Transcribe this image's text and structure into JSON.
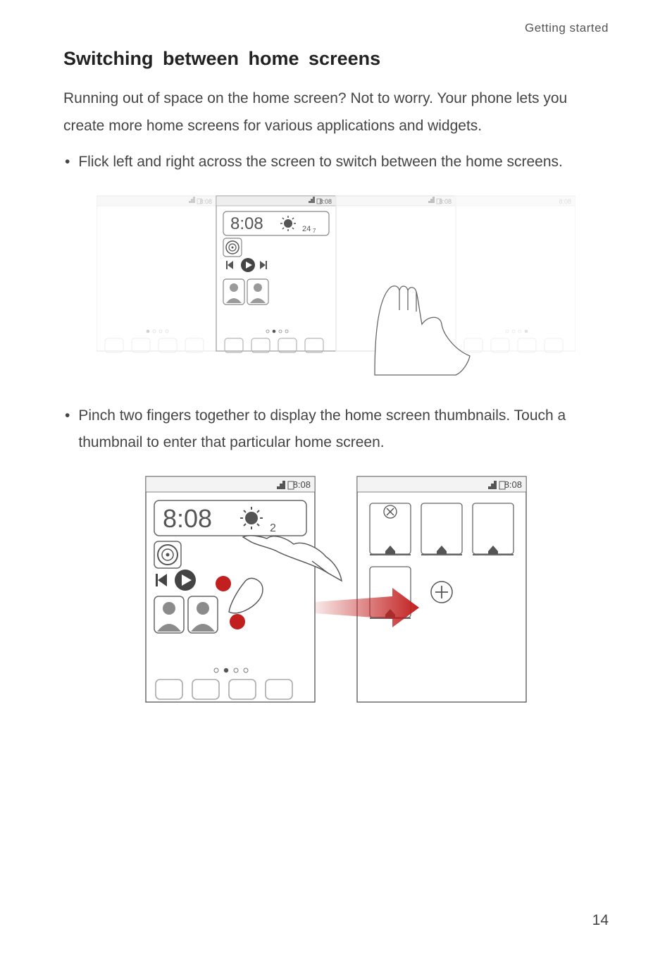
{
  "header": {
    "running_title": "Getting started"
  },
  "section": {
    "title": "Switching  between  home  screens"
  },
  "intro": {
    "text": "Running out of space on the home screen? Not to worry. Your phone lets you create more home screens for various applications and widgets."
  },
  "bullets": [
    {
      "text": "Flick left and right across the screen to switch between the home screens."
    },
    {
      "text": "Pinch two fingers together to display the home screen thumbnails. Touch a thumbnail to enter that particular home screen."
    }
  ],
  "figure1": {
    "time": "8:08",
    "status_time": "8:08",
    "temperature_suffix": "24",
    "unit_suffix": "7"
  },
  "figure2": {
    "time": "8:08",
    "status_time": "8:08",
    "screen2_status_time": "8:08"
  },
  "page_number": "14"
}
